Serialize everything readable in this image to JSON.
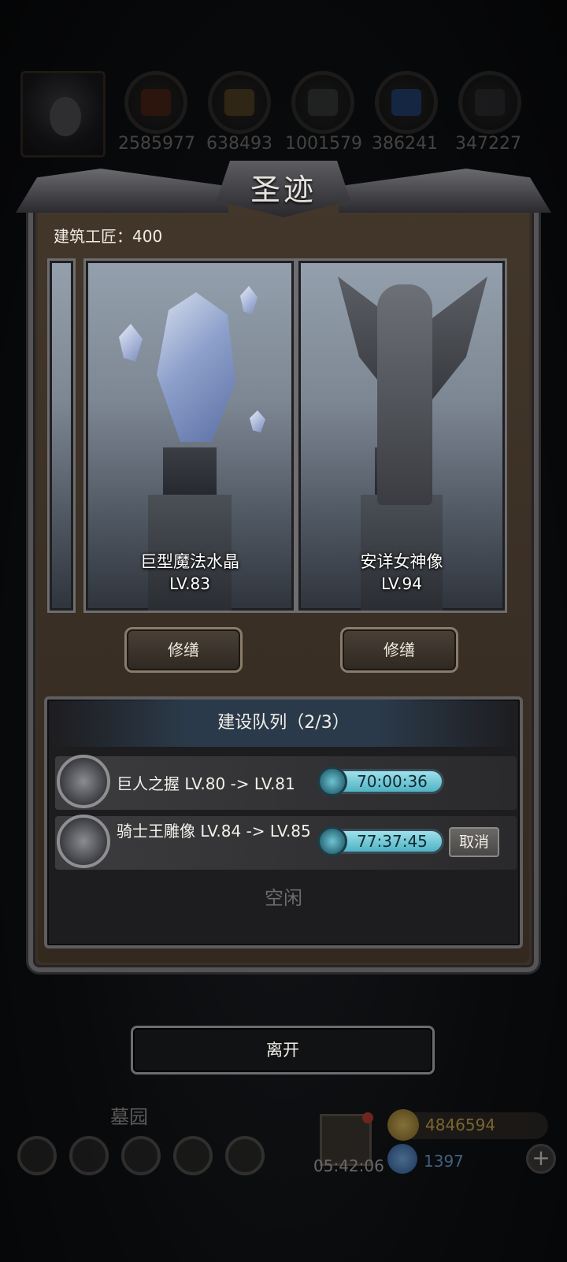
{
  "resources": {
    "values": [
      "2585977",
      "638493",
      "1001579",
      "386241",
      "347227"
    ],
    "icons": [
      "meat-icon",
      "wood-icon",
      "iron-icon",
      "crystal-icon",
      "stone-icon"
    ]
  },
  "modal": {
    "title": "圣迹",
    "builder_label": "建筑工匠：400",
    "cards": [
      {
        "name": "巨型魔法水晶",
        "level": "LV.83",
        "button": "修缮"
      },
      {
        "name": "安详女神像",
        "level": "LV.94",
        "button": "修缮"
      }
    ],
    "queue": {
      "title": "建设队列（2/3）",
      "items": [
        {
          "text": "巨人之握 LV.80 -> LV.81",
          "timer": "70:00:36"
        },
        {
          "text": "骑士王雕像 LV.84 -> LV.85",
          "timer": "77:37:45",
          "cancel": "取消"
        }
      ],
      "idle": "空闲"
    },
    "exit_button": "离开"
  },
  "bottom": {
    "place": "墓园",
    "gift_timer": "05:42:06",
    "gold": "4846594",
    "gems": "1397",
    "plus": "+"
  },
  "colors": {
    "timer_fill": "#6fc8d6",
    "panel_brown": "#3b3026",
    "frame_silver": "#565457"
  }
}
